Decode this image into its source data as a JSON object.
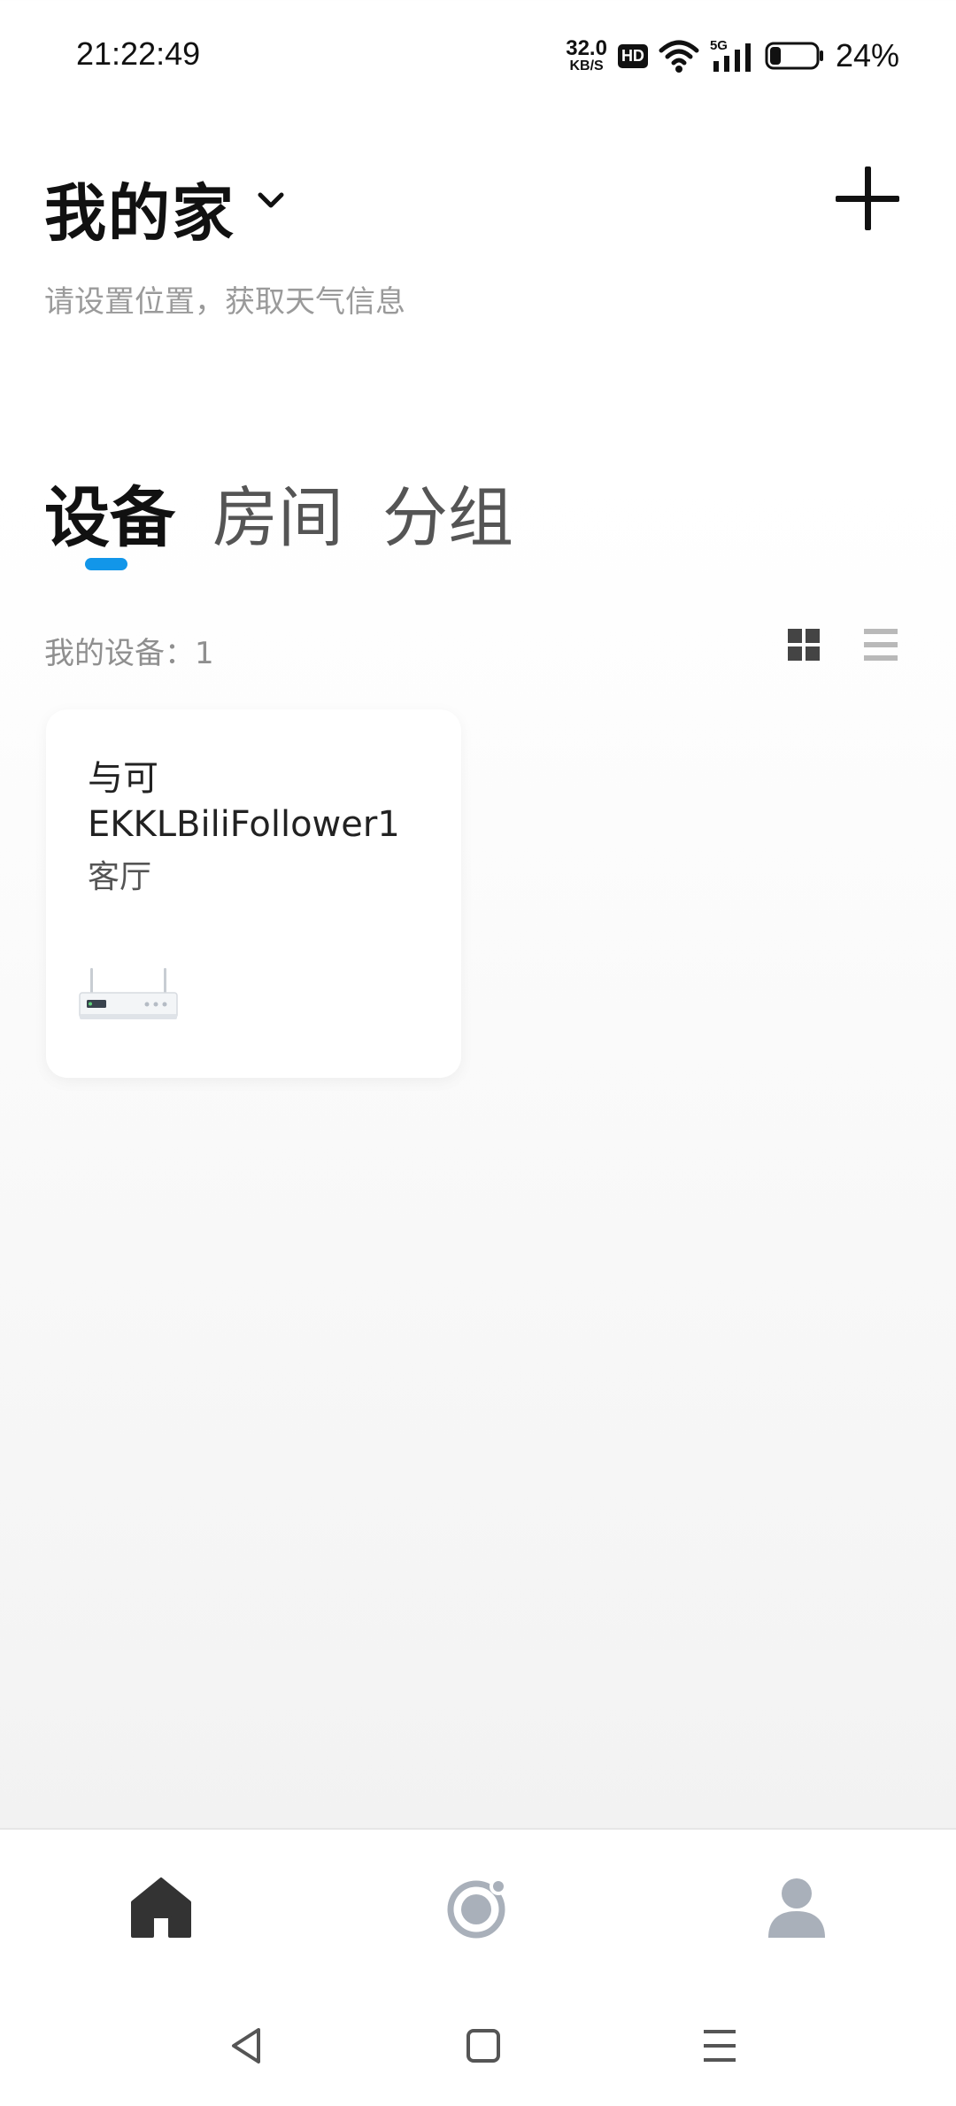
{
  "status_bar": {
    "time": "21:22:49",
    "net_speed_value": "32.0",
    "net_speed_unit": "KB/S",
    "hd_label": "HD",
    "signal_label": "5G",
    "battery_level": 0.24,
    "battery_text": "24%"
  },
  "header": {
    "home_name": "我的家",
    "weather_hint": "请设置位置，获取天气信息"
  },
  "tabs": [
    {
      "label": "设备",
      "active": true
    },
    {
      "label": "房间",
      "active": false
    },
    {
      "label": "分组",
      "active": false
    }
  ],
  "device_summary": {
    "label": "我的设备：1"
  },
  "devices": [
    {
      "name": "与可EKKLBiliFollower1",
      "room": "客厅",
      "icon": "router-icon"
    }
  ],
  "bottom_nav": [
    {
      "icon": "home-icon",
      "active": true
    },
    {
      "icon": "scene-icon",
      "active": false
    },
    {
      "icon": "profile-icon",
      "active": false
    }
  ],
  "colors": {
    "accent": "#1296e9",
    "nav_active": "#333333",
    "nav_inactive": "#a9b0ba"
  }
}
